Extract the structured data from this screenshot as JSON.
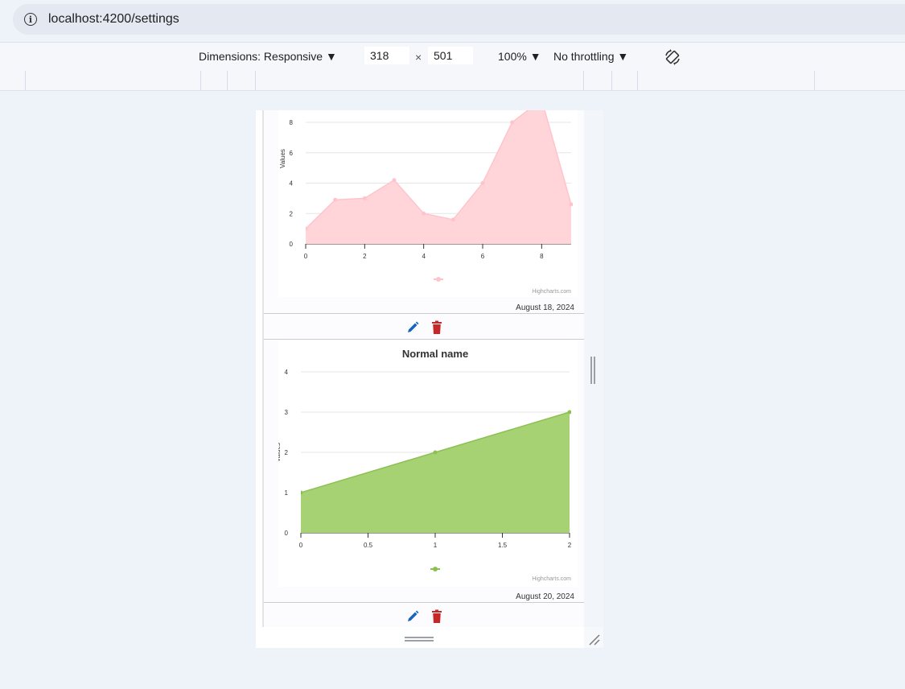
{
  "browser": {
    "url": "localhost:4200/settings",
    "info_icon": "info-icon"
  },
  "device_toolbar": {
    "dimensions_label": "Dimensions: Responsive ▼",
    "width": "318",
    "times": "×",
    "height": "501",
    "zoom": "100% ▼",
    "throttling": "No throttling ▼",
    "rotate_icon": "rotate-icon"
  },
  "cards": [
    {
      "date": "August 18, 2024",
      "credit": "Highcharts.com",
      "edit_icon": "pencil-icon",
      "delete_icon": "trash-icon"
    },
    {
      "date": "August 20, 2024",
      "credit": "Highcharts.com",
      "edit_icon": "pencil-icon",
      "delete_icon": "trash-icon"
    }
  ],
  "chart_data": [
    {
      "type": "area",
      "title": "",
      "xlabel": "",
      "ylabel": "Values",
      "x": [
        0,
        1,
        2,
        3,
        4,
        5,
        6,
        7,
        8,
        9
      ],
      "values": [
        1,
        2.9,
        3,
        4.2,
        2,
        1.6,
        4,
        8,
        9.5,
        2.6
      ],
      "xlim": [
        0,
        9
      ],
      "ylim": [
        0,
        8
      ],
      "xticks": [
        0,
        2,
        4,
        6,
        8
      ],
      "yticks": [
        0,
        2,
        4,
        6,
        8
      ],
      "color": "#ffd5da",
      "marker_color": "#ffc4cb",
      "grid": true,
      "legend": "bottom-center"
    },
    {
      "type": "area",
      "title": "Normal name",
      "xlabel": "",
      "ylabel": "Values",
      "x": [
        0,
        1,
        2
      ],
      "values": [
        1,
        2,
        3
      ],
      "xlim": [
        0,
        2
      ],
      "ylim": [
        0,
        4
      ],
      "xticks": [
        0,
        0.5,
        1,
        1.5,
        2
      ],
      "yticks": [
        0,
        1,
        2,
        3,
        4
      ],
      "color": "#a6d274",
      "marker_color": "#8cc152",
      "grid": true,
      "legend": "bottom-center"
    }
  ],
  "colors": {
    "edit": "#1565c0",
    "delete": "#c62828"
  }
}
